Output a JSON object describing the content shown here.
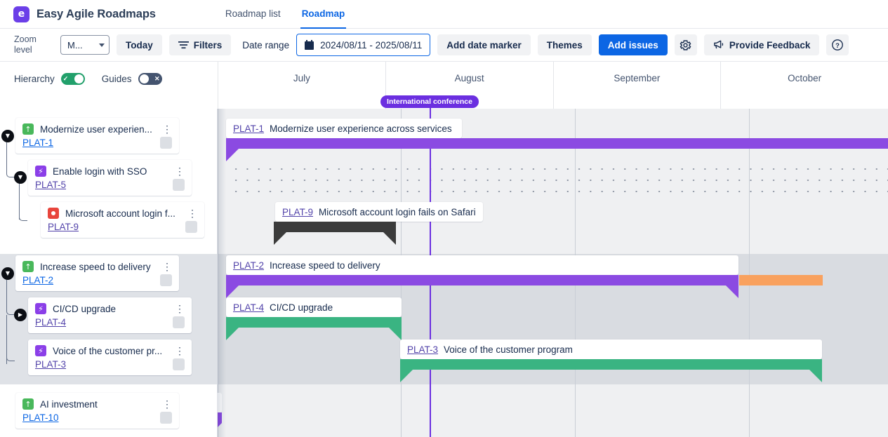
{
  "header": {
    "logo_letter": "e",
    "brand": "Easy Agile Roadmaps",
    "tabs": [
      {
        "label": "Roadmap list",
        "active": false
      },
      {
        "label": "Roadmap",
        "active": true
      }
    ]
  },
  "toolbar": {
    "zoom_level_label": "Zoom level",
    "zoom_select_value": "M...",
    "today_label": "Today",
    "filters_label": "Filters",
    "date_range_label": "Date range",
    "date_range_value": "2024/08/11 - 2025/08/11",
    "add_date_marker_label": "Add date marker",
    "themes_label": "Themes",
    "add_issues_label": "Add issues",
    "settings_icon": "gear-icon",
    "provide_feedback_label": "Provide Feedback",
    "feedback_icon": "megaphone-icon",
    "help_icon": "question-circle-icon",
    "accent_primary": "#0c66e4"
  },
  "controls": {
    "hierarchy_label": "Hierarchy",
    "hierarchy_on": true,
    "hierarchy_glyph": "✓",
    "guides_label": "Guides",
    "guides_on": false,
    "guides_glyph": "✕"
  },
  "timeline": {
    "months": [
      "July",
      "August",
      "September",
      "October"
    ],
    "marker": {
      "label": "International conference",
      "color": "#6b2fe0"
    }
  },
  "issues": [
    {
      "key": "PLAT-1",
      "title": "Modernize user experien...",
      "full_title": "Modernize user experience across services",
      "type": "epic",
      "type_icon": "arrow-up-icon",
      "level": 0,
      "expanded": true,
      "bar_color": "#8b4ae2"
    },
    {
      "key": "PLAT-5",
      "title": "Enable login with SSO",
      "full_title": "Enable login with SSO",
      "type": "story",
      "type_icon": "lightning-bolt-icon",
      "level": 1,
      "expanded": true,
      "bar_color": null
    },
    {
      "key": "PLAT-9",
      "title": "Microsoft account login f...",
      "full_title": "Microsoft account login fails on Safari",
      "type": "bug",
      "type_icon": "bug-circle-icon",
      "level": 2,
      "expanded": null,
      "bar_color": "#3b3b3b"
    },
    {
      "key": "PLAT-2",
      "title": "Increase speed to delivery",
      "full_title": "Increase speed to delivery",
      "type": "epic",
      "type_icon": "arrow-up-icon",
      "level": 0,
      "expanded": true,
      "bar_color": "#8b4ae2"
    },
    {
      "key": "PLAT-4",
      "title": "CI/CD upgrade",
      "full_title": "CI/CD upgrade",
      "type": "story",
      "type_icon": "lightning-bolt-icon",
      "level": 1,
      "expanded": false,
      "bar_color": "#3ab482"
    },
    {
      "key": "PLAT-3",
      "title": "Voice of the customer pr...",
      "full_title": "Voice of the customer program",
      "type": "story",
      "type_icon": "lightning-bolt-icon",
      "level": 1,
      "expanded": null,
      "bar_color": "#3ab482"
    },
    {
      "key": "PLAT-10",
      "title": "AI investment",
      "full_title": "AI investment",
      "type": "epic",
      "type_icon": "arrow-up-icon",
      "level": 0,
      "expanded": null,
      "bar_color": "#8b4ae2"
    }
  ]
}
